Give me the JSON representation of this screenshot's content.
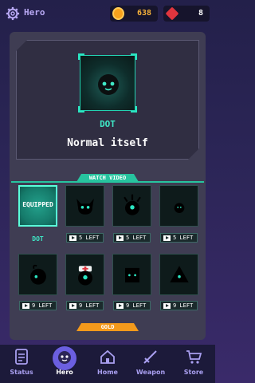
{
  "header": {
    "title": "Hero",
    "coins": "638",
    "gems": "8",
    "icons": {
      "settings": "gear-icon",
      "coin": "coin-icon",
      "gem": "gem-icon"
    }
  },
  "selected_hero": {
    "name": "DOT",
    "description": "Normal itself"
  },
  "sections": {
    "watch_video": "WATCH VIDEO",
    "gold": "GOLD"
  },
  "tiles": [
    {
      "label": "EQUIPPED",
      "name": "DOT"
    },
    {
      "watch": "5 LEFT"
    },
    {
      "watch": "5 LEFT"
    },
    {
      "watch": "5 LEFT"
    },
    {
      "watch": "9 LEFT"
    },
    {
      "watch": "9 LEFT"
    },
    {
      "watch": "9 LEFT"
    },
    {
      "watch": "9 LEFT"
    }
  ],
  "nav": [
    {
      "label": "Status",
      "icon": "status-icon"
    },
    {
      "label": "Hero",
      "icon": "hero-icon",
      "active": true
    },
    {
      "label": "Home",
      "icon": "home-icon"
    },
    {
      "label": "Weapon",
      "icon": "sword-icon"
    },
    {
      "label": "Store",
      "icon": "cart-icon"
    }
  ],
  "colors": {
    "accent": "#3fe8c6",
    "nav_active": "#6b5fe0",
    "gold": "#f39a1b",
    "gem": "#e0353e"
  }
}
